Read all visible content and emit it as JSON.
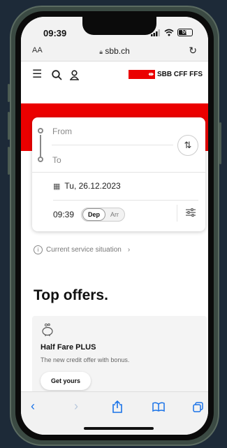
{
  "status_bar": {
    "time": "09:39",
    "battery": "59"
  },
  "browser": {
    "text_size_label": "AA",
    "url": "sbb.ch",
    "reload_icon": "reload-icon"
  },
  "header": {
    "logo_text": "SBB CFF FFS",
    "menu_icon": "hamburger-icon",
    "search_icon": "search-icon",
    "account_icon": "user-icon"
  },
  "timetable": {
    "from_placeholder": "From",
    "to_placeholder": "To",
    "date": "Tu, 26.12.2023",
    "time": "09:39",
    "mode_options": [
      "Dep",
      "Arr"
    ],
    "selected_mode": "Dep"
  },
  "service": {
    "label": "Current service situation"
  },
  "offers": {
    "heading": "Top offers.",
    "cards": [
      {
        "title": "Half Fare PLUS",
        "description": "The new credit offer with bonus.",
        "button": "Get yours"
      }
    ]
  },
  "colors": {
    "brand_red": "#eb0000",
    "link_blue": "#1a73e8"
  }
}
